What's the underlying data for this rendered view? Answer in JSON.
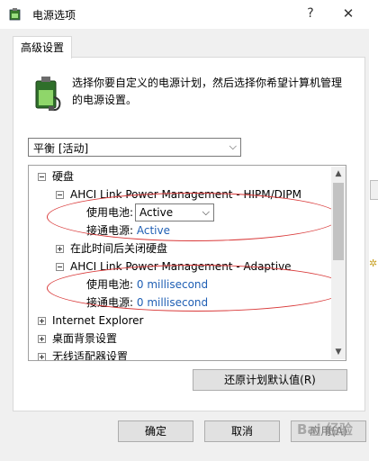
{
  "window": {
    "title": "电源选项",
    "help_glyph": "?",
    "close_glyph": "✕"
  },
  "tab": {
    "label": "高级设置"
  },
  "description": "选择你要自定义的电源计划，然后选择你希望计算机管理的电源设置。",
  "plan_select": {
    "value": "平衡 [活动]"
  },
  "tree": {
    "hard_disk": "硬盘",
    "hipm": {
      "label": "AHCI Link Power Management - HIPM/DIPM",
      "battery_label": "使用电池:",
      "battery_value": "Active",
      "plugged_label": "接通电源:",
      "plugged_value": "Active"
    },
    "turn_off_disk": "在此时间后关闭硬盘",
    "adaptive": {
      "label": "AHCI Link Power Management - Adaptive",
      "battery_label": "使用电池:",
      "battery_value": "0 millisecond",
      "plugged_label": "接通电源:",
      "plugged_value": "0 millisecond"
    },
    "ie": "Internet Explorer",
    "desktop_bg": "桌面背景设置",
    "wireless": "无线适配器设置"
  },
  "buttons": {
    "restore": "还原计划默认值(R)",
    "ok": "确定",
    "cancel": "取消",
    "apply": "应用(A)"
  },
  "watermark": "Bai 经验",
  "colors": {
    "annotation_red": "#d93a3a",
    "value_blue": "#1f5fb4"
  }
}
